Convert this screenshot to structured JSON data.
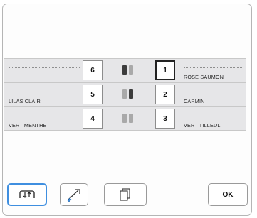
{
  "left_rows": [
    {
      "number": "6",
      "label": ""
    },
    {
      "number": "5",
      "label": "LILAS CLAIR"
    },
    {
      "number": "4",
      "label": "VERT MENTHE"
    }
  ],
  "right_rows": [
    {
      "number": "1",
      "label": "ROSE SAUMON"
    },
    {
      "number": "2",
      "label": "CARMIN"
    },
    {
      "number": "3",
      "label": "VERT TILLEUL"
    }
  ],
  "footer": {
    "ok_label": "OK",
    "buttons": [
      "thread-sort-icon",
      "thread-cutter-icon",
      "copy-icon"
    ]
  },
  "colors": {
    "spool_dark": "#3c3c3c",
    "spool_light": "#a9a9a9",
    "active_border": "#3f8fe0"
  }
}
